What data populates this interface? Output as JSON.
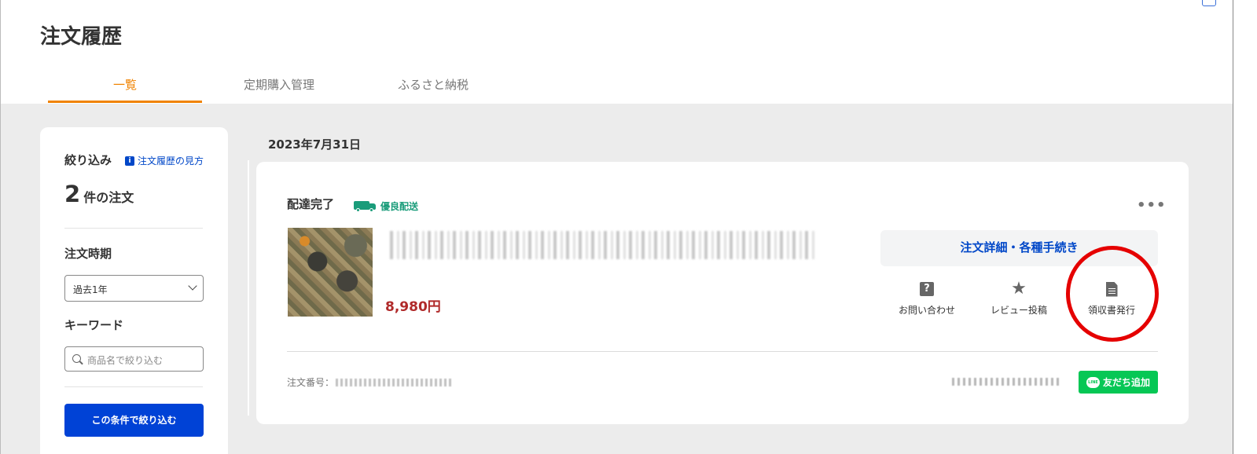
{
  "page": {
    "title": "注文履歴"
  },
  "tabs": [
    {
      "label": "一覧",
      "active": true
    },
    {
      "label": "定期購入管理",
      "active": false
    },
    {
      "label": "ふるさと納税",
      "active": false
    }
  ],
  "sidebar": {
    "filter_title": "絞り込み",
    "howto_link": "注文履歴の見方",
    "count_number": "2",
    "count_suffix": "件の注文",
    "period_label": "注文時期",
    "period_value": "過去1年",
    "keyword_label": "キーワード",
    "keyword_placeholder": "商品名で絞り込む",
    "submit_label": "この条件で絞り込む"
  },
  "order": {
    "date": "2023年7月31日",
    "status": "配達完了",
    "badge": "優良配送",
    "price": "8,980円",
    "detail_button": "注文詳細・各種手続き",
    "actions": [
      {
        "label": "お問い合わせ",
        "icon": "question-icon"
      },
      {
        "label": "レビュー投稿",
        "icon": "star-icon"
      },
      {
        "label": "領収書発行",
        "icon": "document-icon"
      }
    ],
    "order_number_label": "注文番号：",
    "line_button": "友だち追加"
  },
  "colors": {
    "accent": "#f08300",
    "link": "#0047c8",
    "price": "#b02a2a",
    "line": "#06c755",
    "highlight": "#e50000"
  }
}
